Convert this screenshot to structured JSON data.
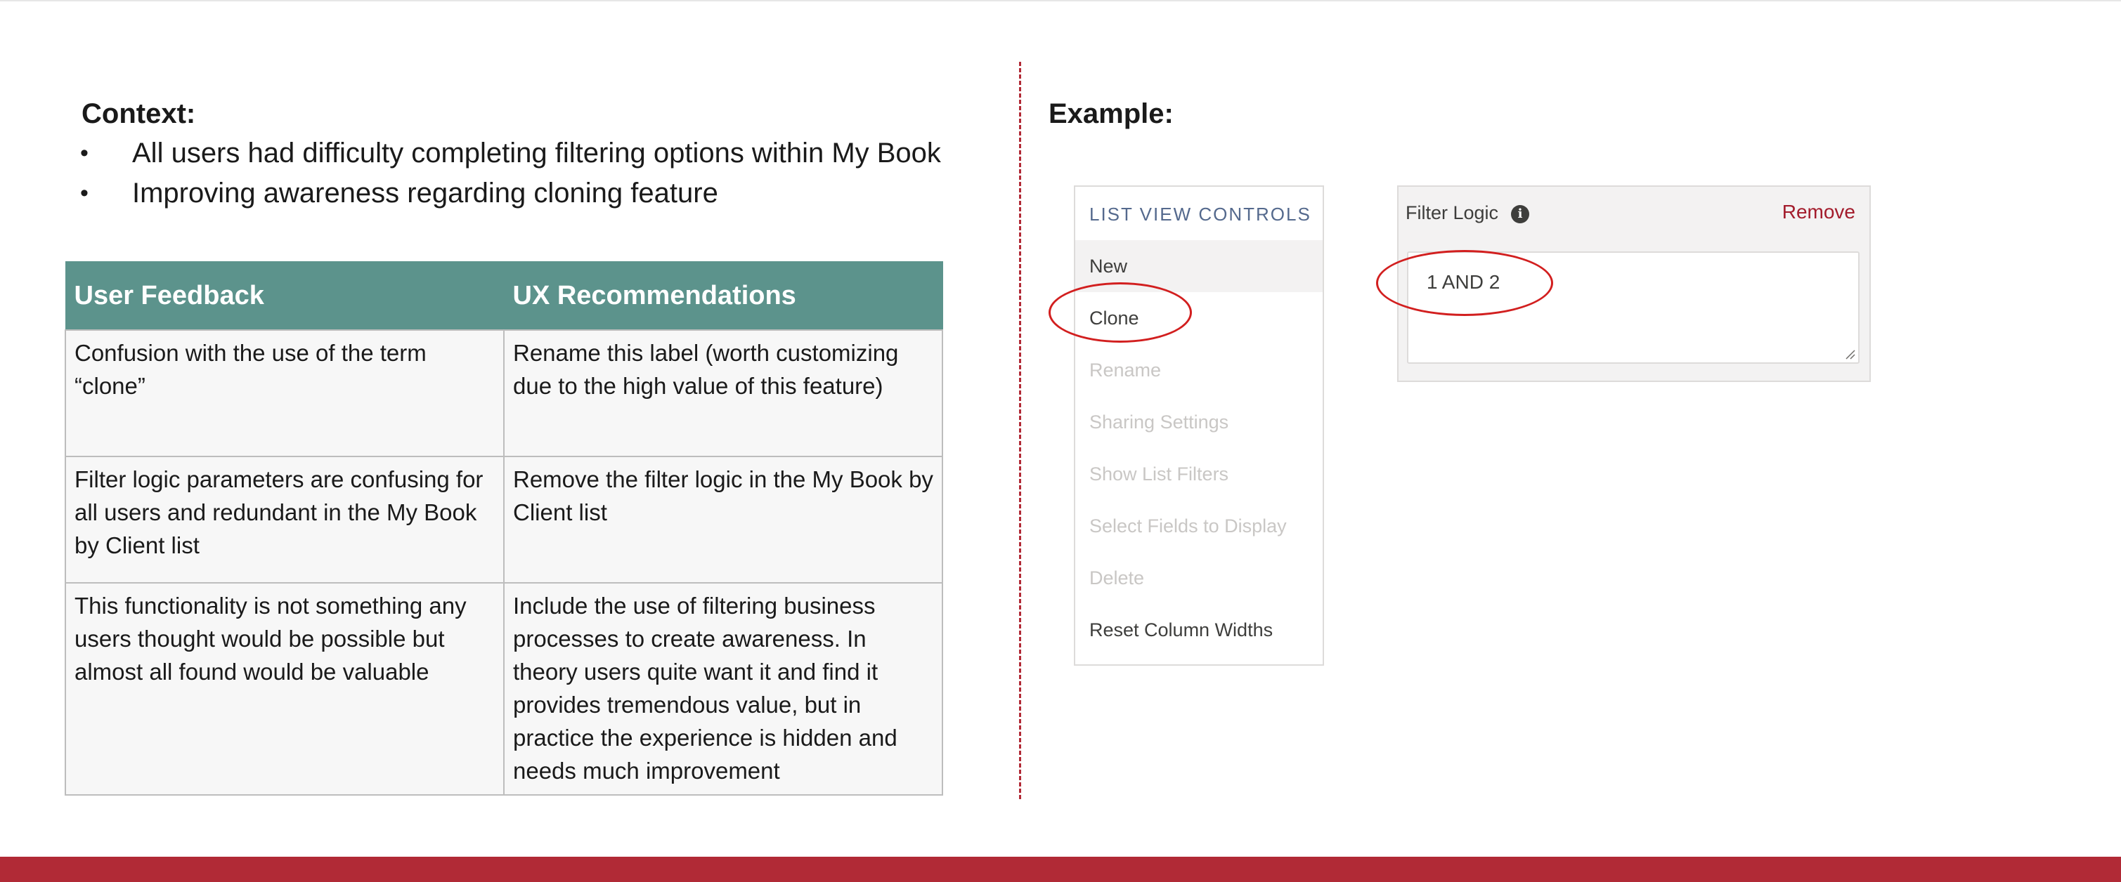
{
  "context": {
    "heading": "Context:",
    "bullets": [
      "All users had difficulty completing filtering options within My Book",
      "Improving awareness regarding cloning feature"
    ]
  },
  "table": {
    "headers": [
      "User Feedback",
      "UX Recommendations"
    ],
    "rows": [
      [
        "Confusion with the use of the term “clone”",
        "Rename this label (worth customizing due to the high value of this feature)"
      ],
      [
        "Filter logic parameters are confusing for all users and redundant in the My Book by Client list",
        "Remove the filter logic in the My Book by Client list"
      ],
      [
        "This functionality is not something any users thought would be possible but almost all found would be valuable",
        "Include the use of filtering business processes to create awareness. In theory users quite want it and find it provides tremendous value, but in practice the experience is hidden and needs much improvement"
      ]
    ]
  },
  "example": {
    "heading": "Example:",
    "menu": {
      "title": "LIST VIEW CONTROLS",
      "items": [
        {
          "label": "New",
          "state": "highlighted"
        },
        {
          "label": "Clone",
          "state": "active"
        },
        {
          "label": "Rename",
          "state": "disabled"
        },
        {
          "label": "Sharing Settings",
          "state": "disabled"
        },
        {
          "label": "Show List Filters",
          "state": "disabled"
        },
        {
          "label": "Select Fields to Display",
          "state": "disabled"
        },
        {
          "label": "Delete",
          "state": "disabled"
        },
        {
          "label": "Reset Column Widths",
          "state": "enabled"
        }
      ]
    },
    "filter_panel": {
      "label": "Filter Logic",
      "info_icon": "info-icon",
      "remove_label": "Remove",
      "value": "1 AND 2"
    }
  },
  "colors": {
    "accent_red": "#b12a36",
    "table_header": "#5c938c",
    "highlight_ring": "#d21f1f"
  }
}
